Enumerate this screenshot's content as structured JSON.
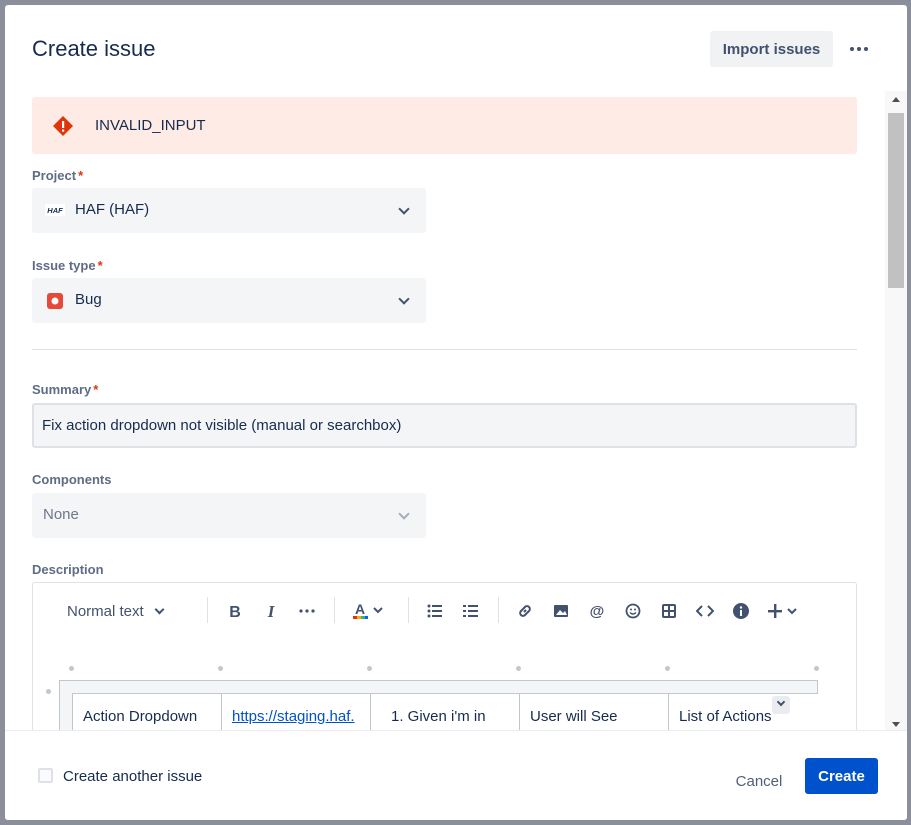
{
  "modal": {
    "title": "Create issue",
    "import_label": "Import issues"
  },
  "error": {
    "text": "INVALID_INPUT"
  },
  "fields": {
    "project": {
      "label": "Project",
      "required": "*",
      "value": "HAF (HAF)",
      "icon_text": "HAF"
    },
    "issue_type": {
      "label": "Issue type",
      "required": "*",
      "value": "Bug"
    },
    "summary": {
      "label": "Summary",
      "required": "*",
      "value": "Fix action dropdown not visible (manual or searchbox)"
    },
    "components": {
      "label": "Components",
      "value": "None"
    },
    "description": {
      "label": "Description"
    }
  },
  "editor": {
    "text_style": "Normal text",
    "table": {
      "cells": [
        "Action Dropdown",
        "https://staging.haf.",
        "1. Given i'm in",
        "User will See",
        "List of Actions"
      ]
    }
  },
  "footer": {
    "create_another_label": "Create another issue",
    "cancel_label": "Cancel",
    "create_label": "Create"
  },
  "colors": {
    "primary": "#0052cc",
    "error_bg": "#ffebe6",
    "error_icon": "#de350b",
    "bug": "#e5493a"
  }
}
